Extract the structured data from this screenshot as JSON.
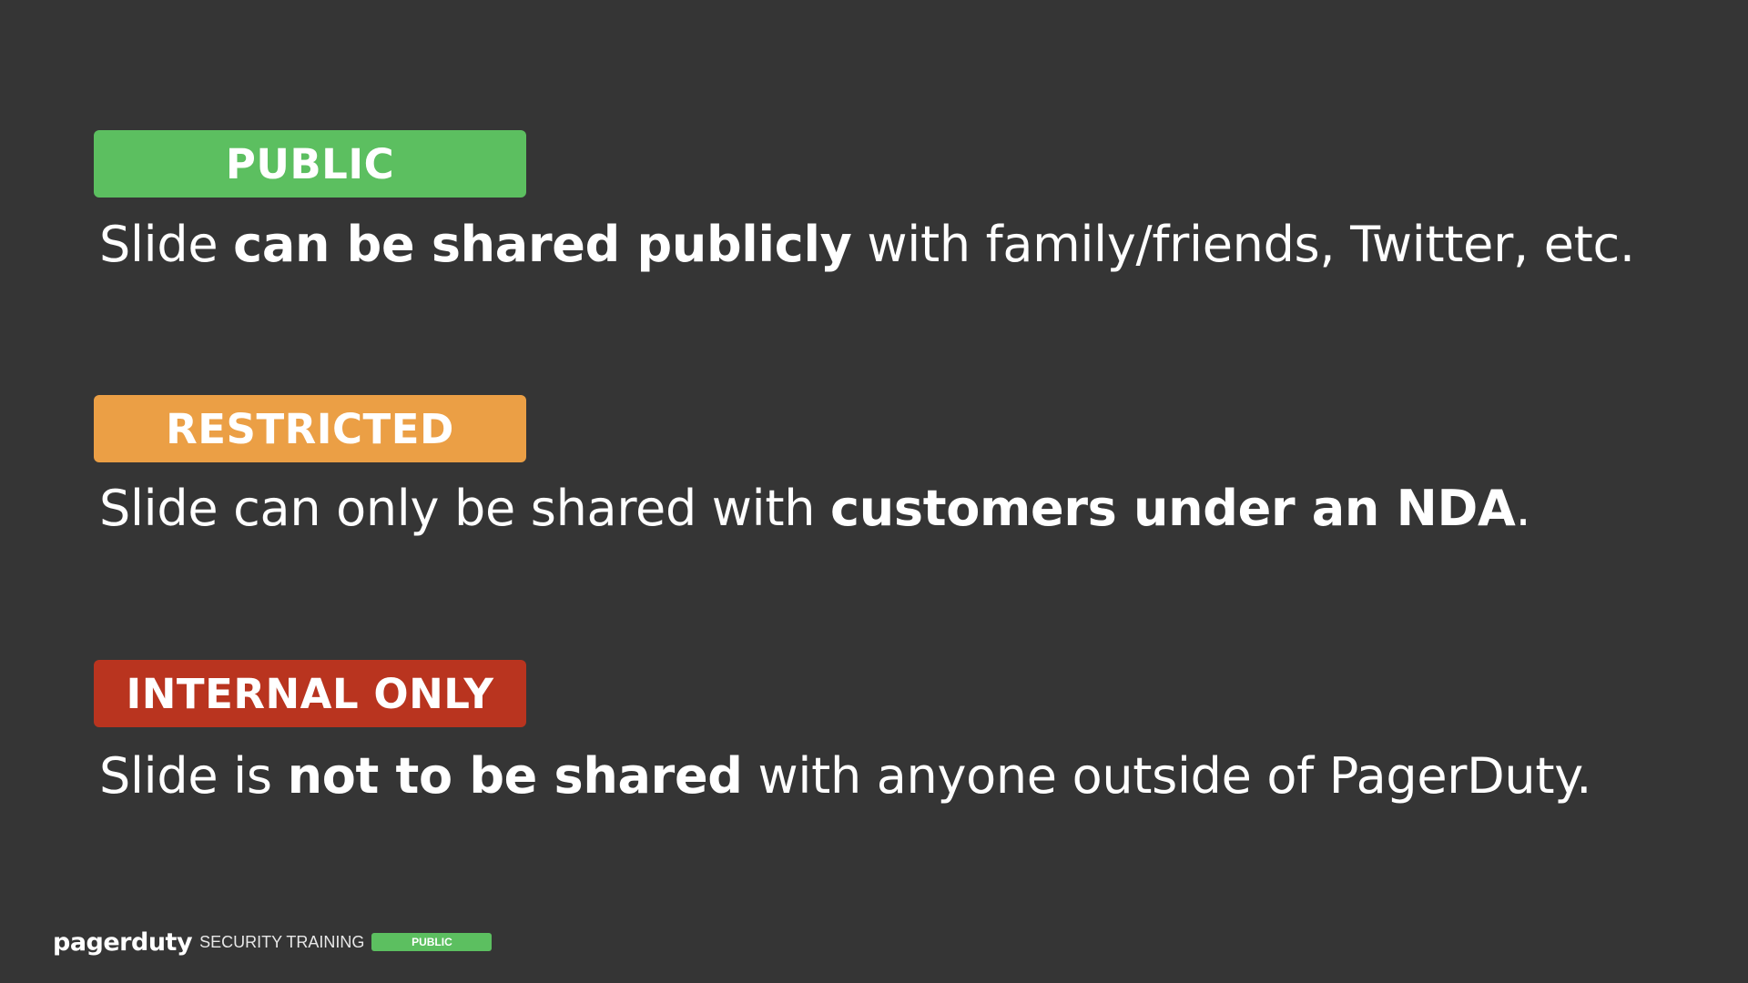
{
  "items": [
    {
      "badge": "PUBLIC",
      "color": "#5cbf60",
      "text_before": "Slide ",
      "text_bold": "can be shared publicly",
      "text_after": " with family/friends, Twitter, etc."
    },
    {
      "badge": "RESTRICTED",
      "color": "#eb9f45",
      "text_before": "Slide can only be shared with ",
      "text_bold": "customers under an NDA",
      "text_after": "."
    },
    {
      "badge": "INTERNAL ONLY",
      "color": "#b9341f",
      "text_before": "Slide is ",
      "text_bold": "not to be shared",
      "text_after": " with anyone outside of PagerDuty."
    }
  ],
  "footer": {
    "logo": "pagerduty",
    "subtitle": "SECURITY TRAINING",
    "badge": "PUBLIC"
  },
  "colors": {
    "background": "#353535",
    "text": "#ffffff"
  }
}
